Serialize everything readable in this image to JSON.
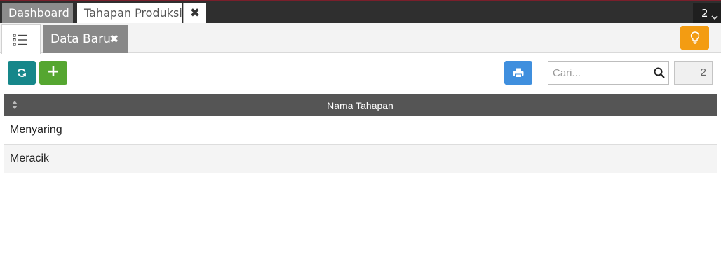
{
  "tabs": {
    "dashboard": "Dashboard",
    "active": "Tahapan Produksi",
    "close_symbol": "✖",
    "open_count": "2"
  },
  "subtabs": {
    "new_data": "Data Baru",
    "close_symbol": "✖"
  },
  "toolbar": {
    "add_symbol": "+",
    "search_placeholder": "Cari...",
    "record_count": "2"
  },
  "table": {
    "header": "Nama Tahapan",
    "rows": [
      "Menyaring",
      "Meracik"
    ]
  },
  "colors": {
    "refresh": "#16878a",
    "add": "#55a630",
    "print": "#3f8fde",
    "tip": "#f39c12",
    "header_bg": "#555555"
  },
  "icons": [
    "list-icon",
    "refresh-icon",
    "plus-icon",
    "printer-icon",
    "search-icon",
    "lightbulb-icon",
    "sort-icon",
    "close-icon",
    "chevron-down-icon"
  ]
}
